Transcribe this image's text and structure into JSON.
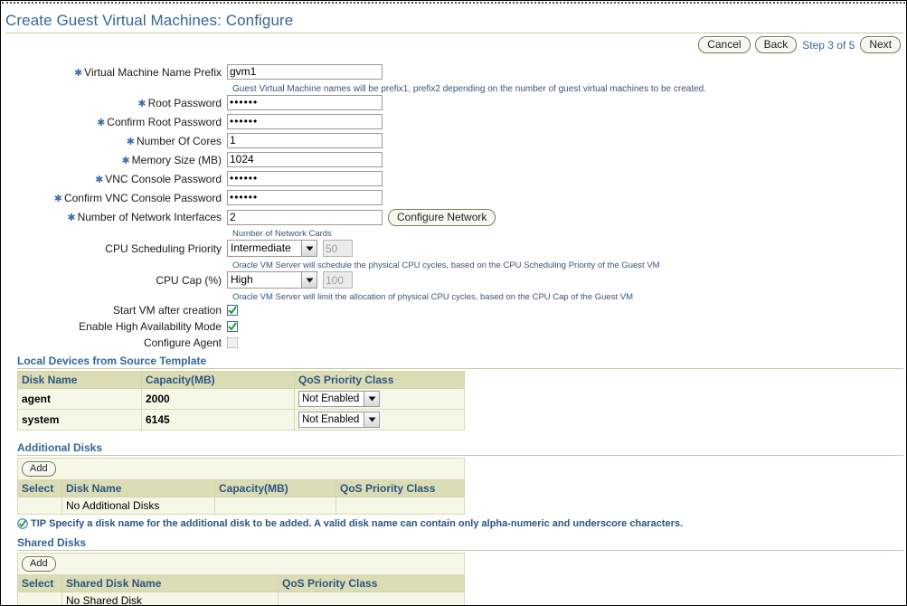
{
  "window": {
    "title": "Create Guest Virtual Machines: Configure"
  },
  "actionbar": {
    "cancel_label": "Cancel",
    "back_label": "Back",
    "step_text": "Step 3 of 5",
    "next_label": "Next"
  },
  "form": {
    "fields": [
      {
        "label": "Virtual Machine Name Prefix",
        "required": true,
        "type": "text",
        "value": "gvm1",
        "hint": "Guest Virtual Machine names will be prefix1, prefix2 depending on the number of guest virtual machines to be created."
      },
      {
        "label": "Root Password",
        "required": true,
        "type": "password",
        "value": "••••••",
        "hint": ""
      },
      {
        "label": "Confirm Root Password",
        "required": true,
        "type": "password",
        "value": "••••••",
        "hint": ""
      },
      {
        "label": "Number Of Cores",
        "required": true,
        "type": "text",
        "value": "1",
        "hint": ""
      },
      {
        "label": "Memory Size (MB)",
        "required": true,
        "type": "text",
        "value": "1024",
        "hint": ""
      },
      {
        "label": "VNC Console Password",
        "required": true,
        "type": "password",
        "value": "••••••",
        "hint": ""
      },
      {
        "label": "Confirm VNC Console Password",
        "required": true,
        "type": "password",
        "value": "••••••",
        "hint": ""
      },
      {
        "label": "Number of Network Interfaces",
        "required": true,
        "type": "text",
        "value": "2",
        "button_label": "Configure Network",
        "hint": "Number of Network Cards"
      }
    ],
    "cpu_scheduling": {
      "label": "CPU Scheduling Priority",
      "required": false,
      "selected": "Intermediate",
      "options": [
        "Intermediate"
      ],
      "number_value": "50",
      "hint": "Oracle VM Server will schedule the physical CPU cycles, based on the CPU Scheduling Priority of the Guest VM"
    },
    "cpu_cap": {
      "label": "CPU Cap (%)",
      "required": false,
      "selected": "High",
      "options": [
        "High"
      ],
      "number_value": "100",
      "hint": "Oracle VM Server will limit the allocation of physical CPU cycles, based on the CPU Cap of the Guest VM"
    },
    "checkboxes": [
      {
        "label": "Start VM after creation",
        "checked": true
      },
      {
        "label": "Enable High Availability Mode",
        "checked": true
      },
      {
        "label": "Configure Agent",
        "checked": false
      }
    ]
  },
  "local_devices": {
    "title": "Local Devices from Source Template",
    "columns": [
      "Disk Name",
      "Capacity(MB)",
      "QoS Priority Class"
    ],
    "rows": [
      {
        "disk_name": "agent",
        "capacity": "2000",
        "qos": "Not Enabled"
      },
      {
        "disk_name": "system",
        "capacity": "6145",
        "qos": "Not Enabled"
      }
    ]
  },
  "additional_disks": {
    "title": "Additional Disks",
    "add_label": "Add",
    "columns": [
      "Select",
      "Disk Name",
      "Capacity(MB)",
      "QoS Priority Class"
    ],
    "empty_text": "No Additional Disks",
    "tip_prefix": "TIP",
    "tip_text": "Specify a disk name for the additional disk to be added. A valid disk name can contain only alpha-numeric and underscore characters."
  },
  "shared_disks": {
    "title": "Shared Disks",
    "add_label": "Add",
    "columns": [
      "Select",
      "Shared Disk Name",
      "QoS Priority Class"
    ],
    "empty_text": "No Shared Disk"
  },
  "colors": {
    "title_blue": "#336699",
    "rule_olive": "#c8c8a0",
    "table_header": "#dcdcb4",
    "table_row": "#f7f7e8",
    "hint_blue": "#33557f",
    "check_green": "#1f9c1f"
  }
}
